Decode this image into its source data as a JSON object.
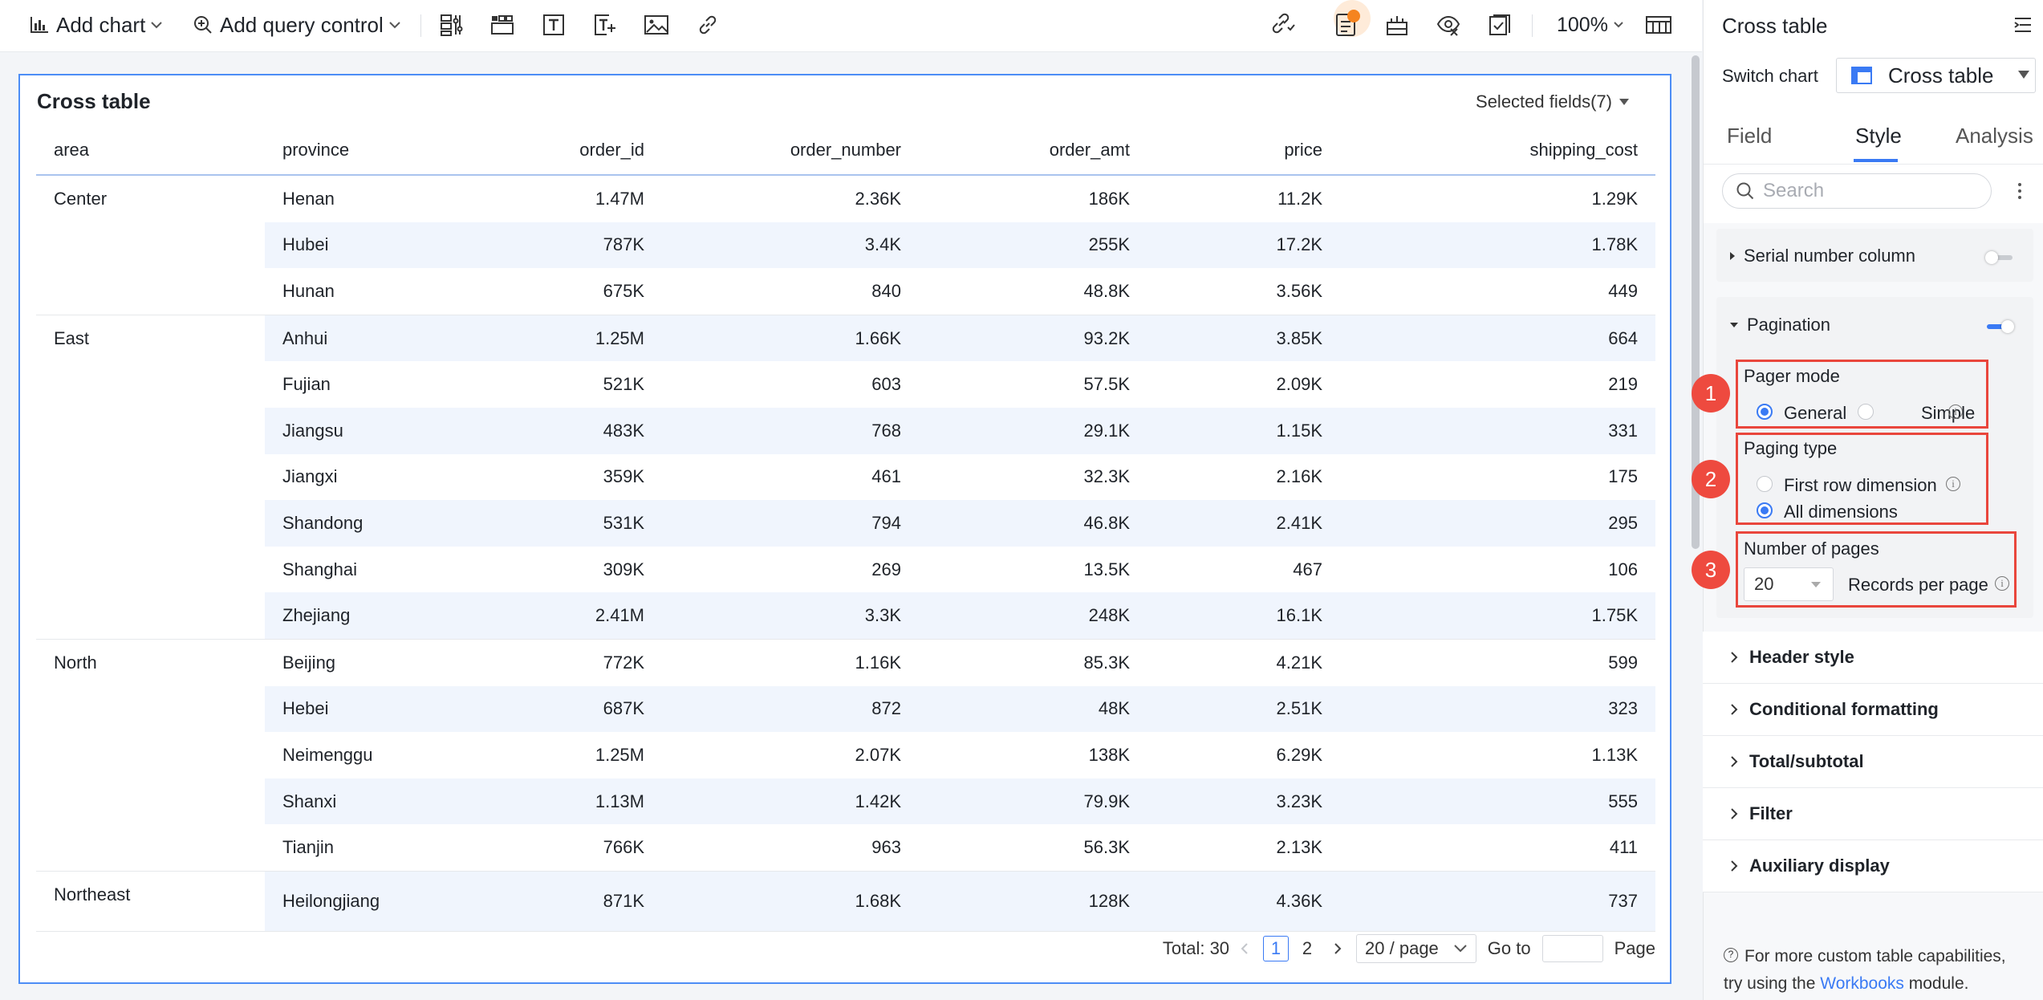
{
  "toolbar": {
    "add_chart": "Add chart",
    "add_query_control": "Add query control",
    "zoom": "100%"
  },
  "card": {
    "title": "Cross table",
    "selected_fields": "Selected fields(7)"
  },
  "table": {
    "headers": [
      "area",
      "province",
      "order_id",
      "order_number",
      "order_amt",
      "price",
      "shipping_cost"
    ],
    "groups": [
      {
        "area": "Center",
        "rows": [
          [
            "Henan",
            "1.47M",
            "2.36K",
            "186K",
            "11.2K",
            "1.29K"
          ],
          [
            "Hubei",
            "787K",
            "3.4K",
            "255K",
            "17.2K",
            "1.78K"
          ],
          [
            "Hunan",
            "675K",
            "840",
            "48.8K",
            "3.56K",
            "449"
          ]
        ]
      },
      {
        "area": "East",
        "rows": [
          [
            "Anhui",
            "1.25M",
            "1.66K",
            "93.2K",
            "3.85K",
            "664"
          ],
          [
            "Fujian",
            "521K",
            "603",
            "57.5K",
            "2.09K",
            "219"
          ],
          [
            "Jiangsu",
            "483K",
            "768",
            "29.1K",
            "1.15K",
            "331"
          ],
          [
            "Jiangxi",
            "359K",
            "461",
            "32.3K",
            "2.16K",
            "175"
          ],
          [
            "Shandong",
            "531K",
            "794",
            "46.8K",
            "2.41K",
            "295"
          ],
          [
            "Shanghai",
            "309K",
            "269",
            "13.5K",
            "467",
            "106"
          ],
          [
            "Zhejiang",
            "2.41M",
            "3.3K",
            "248K",
            "16.1K",
            "1.75K"
          ]
        ]
      },
      {
        "area": "North",
        "rows": [
          [
            "Beijing",
            "772K",
            "1.16K",
            "85.3K",
            "4.21K",
            "599"
          ],
          [
            "Hebei",
            "687K",
            "872",
            "48K",
            "2.51K",
            "323"
          ],
          [
            "Neimenggu",
            "1.25M",
            "2.07K",
            "138K",
            "6.29K",
            "1.13K"
          ],
          [
            "Shanxi",
            "1.13M",
            "1.42K",
            "79.9K",
            "3.23K",
            "555"
          ],
          [
            "Tianjin",
            "766K",
            "963",
            "56.3K",
            "2.13K",
            "411"
          ]
        ]
      },
      {
        "area": "Northeast",
        "rows": [
          [
            "Heilongjiang",
            "871K",
            "1.68K",
            "128K",
            "4.36K",
            "737"
          ]
        ]
      }
    ]
  },
  "pager": {
    "total": "Total: 30",
    "pages": [
      "1",
      "2"
    ],
    "current_page": "1",
    "page_size": "20 / page",
    "goto_label": "Go to",
    "page_label": "Page"
  },
  "panel": {
    "title": "Cross table",
    "switch_chart_label": "Switch chart",
    "switch_chart_value": "Cross table",
    "tabs": [
      "Field",
      "Style",
      "Analysis"
    ],
    "active_tab": "Style",
    "search_placeholder": "Search",
    "serial_column": {
      "label": "Serial number column",
      "enabled": false
    },
    "pagination": {
      "label": "Pagination",
      "enabled": true,
      "pager_mode": {
        "label": "Pager mode",
        "options": [
          "General",
          "Simple"
        ],
        "selected": "General"
      },
      "paging_type": {
        "label": "Paging type",
        "options": [
          "First row dimension",
          "All dimensions"
        ],
        "selected": "All dimensions"
      },
      "number_of_pages": {
        "label": "Number of pages",
        "value": "20",
        "suffix": "Records per page"
      }
    },
    "badges": [
      "1",
      "2",
      "3"
    ],
    "collapsed_sections": [
      "Header style",
      "Conditional formatting",
      "Total/subtotal",
      "Filter",
      "Auxiliary display"
    ],
    "footer": {
      "text": "For more custom table capabilities, try using the",
      "link": "Workbooks",
      "suffix": "module."
    }
  },
  "colors": {
    "accent": "#3a7af4",
    "card_border": "#4c8df6",
    "highlight_red": "#e9463c",
    "row_alt": "#f0f5fd",
    "notification": "#f5841f"
  }
}
